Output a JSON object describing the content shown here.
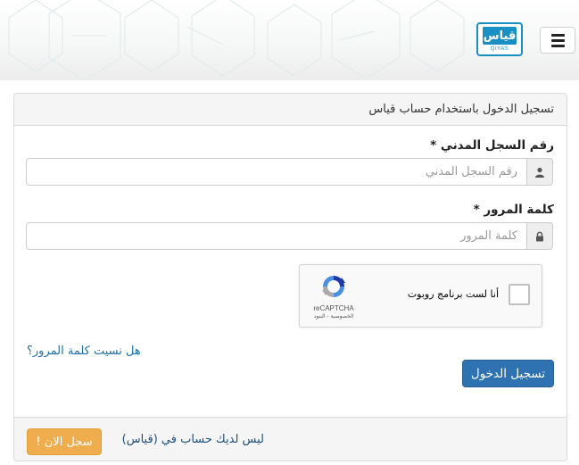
{
  "header": {
    "logo_sub": "QIYAS",
    "logo_mark": "قياس"
  },
  "panel": {
    "title": "تسجيل الدخول باستخدام حساب قياس"
  },
  "form": {
    "national_id_label": "رقم السجل المدني *",
    "national_id_placeholder": "رقم السجل المدني",
    "national_id_value": "",
    "password_label": "كلمة المرور *",
    "password_placeholder": "كلمة المرور",
    "password_value": ""
  },
  "recaptcha": {
    "checkbox_label": "أنا لست برنامج روبوت",
    "brand_name": "reCAPTCHA",
    "links": "الخصوصية - البنود"
  },
  "actions": {
    "forgot_password": "هل نسيت كلمة المرور؟",
    "login_label": "تسجيل الدخول"
  },
  "footer": {
    "no_account_text": "ليس لديك حساب في (قياس)",
    "register_label": "سجل الان !"
  },
  "colors": {
    "primary": "#2f72b2",
    "warning": "#f0ad4e",
    "link": "#1f6fa6",
    "logo": "#1a8fc4"
  },
  "icons": {
    "menu": "hamburger-icon",
    "user": "user-icon",
    "lock": "lock-icon",
    "recaptcha": "recaptcha-icon"
  }
}
